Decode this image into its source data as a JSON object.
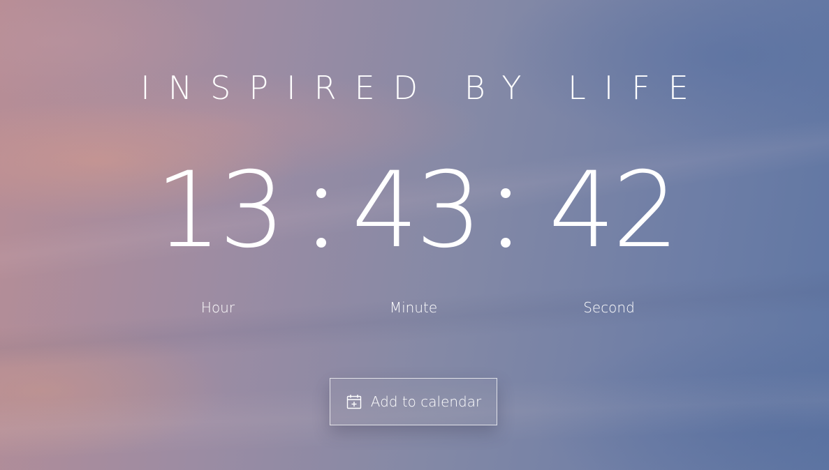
{
  "tagline": "INSPIRED BY LIFE",
  "clock": {
    "hour": "13",
    "minute": "43",
    "second": "42",
    "separator": ":"
  },
  "labels": {
    "hour": "Hour",
    "minute": "Minute",
    "second": "Second"
  },
  "calendar_button": {
    "label": "Add to calendar",
    "icon": "calendar-add-icon"
  },
  "colors": {
    "text": "#ffffff",
    "background_warm": "#b88d95",
    "background_cool": "#5f76a3"
  }
}
